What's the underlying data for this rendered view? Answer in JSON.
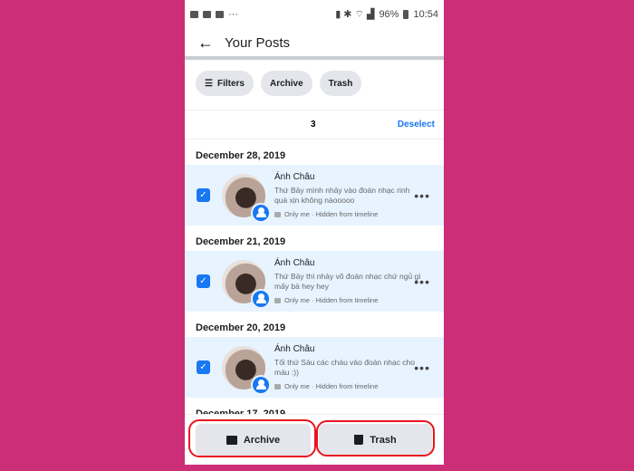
{
  "status": {
    "icons": [
      "image-icon",
      "message-icon",
      "mail-icon",
      "more-icon"
    ],
    "battery": "96%",
    "time": "10:54",
    "dots": "···"
  },
  "header": {
    "title": "Your Posts"
  },
  "chips": [
    {
      "label": "Filters",
      "icon": "sliders-icon"
    },
    {
      "label": "Archive"
    },
    {
      "label": "Trash"
    }
  ],
  "selection": {
    "count": "3",
    "deselect": "Deselect"
  },
  "posts": [
    {
      "date": "December 28, 2019",
      "name": "Ánh Châu",
      "text": "Thứ Bảy mình nhảy vào đoán nhạc rinh quà xịn không nàooooo",
      "meta": "Only me · Hidden from timeline",
      "checked": true
    },
    {
      "date": "December 21, 2019",
      "name": "Ánh Châu",
      "text": "Thứ Bảy thì nhảy vô đoán nhạc chứ ngủ gì mấy bà hey hey",
      "meta": "Only me · Hidden from timeline",
      "checked": true
    },
    {
      "date": "December 20, 2019",
      "name": "Ánh Châu",
      "text": "Tối thứ Sáu các cháu vào đoán nhạc cho máu :))",
      "meta": "Only me · Hidden from timeline",
      "checked": true
    }
  ],
  "next_date": "December 17, 2019",
  "actions": {
    "archive": "Archive",
    "trash": "Trash"
  },
  "colors": {
    "accent": "#1877f2",
    "selected_bg": "#e7f3ff",
    "background": "#cc2f78",
    "highlight_ring": "#e8141e"
  }
}
